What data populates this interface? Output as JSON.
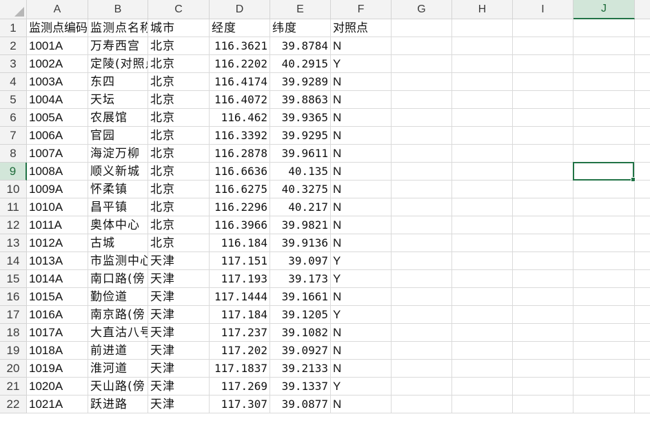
{
  "sheet": {
    "columns": [
      "A",
      "B",
      "C",
      "D",
      "E",
      "F",
      "G",
      "H",
      "I",
      "J"
    ],
    "active_column": "J",
    "active_row": 9,
    "rows": [
      {
        "n": "1",
        "a": "监测点编码",
        "b": "监测点名称",
        "c": "城市",
        "d": "经度",
        "e": "纬度",
        "f": "对照点"
      },
      {
        "n": "2",
        "a": "1001A",
        "b": "万寿西宫",
        "c": "北京",
        "d": "116.3621",
        "e": "39.8784",
        "f": "N"
      },
      {
        "n": "3",
        "a": "1002A",
        "b": "定陵(对照点)",
        "c": "北京",
        "d": "116.2202",
        "e": "40.2915",
        "f": "Y"
      },
      {
        "n": "4",
        "a": "1003A",
        "b": "东四",
        "c": "北京",
        "d": "116.4174",
        "e": "39.9289",
        "f": "N"
      },
      {
        "n": "5",
        "a": "1004A",
        "b": "天坛",
        "c": "北京",
        "d": "116.4072",
        "e": "39.8863",
        "f": "N"
      },
      {
        "n": "6",
        "a": "1005A",
        "b": "农展馆",
        "c": "北京",
        "d": "116.462",
        "e": "39.9365",
        "f": "N"
      },
      {
        "n": "7",
        "a": "1006A",
        "b": "官园",
        "c": "北京",
        "d": "116.3392",
        "e": "39.9295",
        "f": "N"
      },
      {
        "n": "8",
        "a": "1007A",
        "b": "海淀万柳",
        "c": "北京",
        "d": "116.2878",
        "e": "39.9611",
        "f": "N"
      },
      {
        "n": "9",
        "a": "1008A",
        "b": "顺义新城",
        "c": "北京",
        "d": "116.6636",
        "e": "40.135",
        "f": "N"
      },
      {
        "n": "10",
        "a": "1009A",
        "b": "怀柔镇",
        "c": "北京",
        "d": "116.6275",
        "e": "40.3275",
        "f": "N"
      },
      {
        "n": "11",
        "a": "1010A",
        "b": "昌平镇",
        "c": "北京",
        "d": "116.2296",
        "e": "40.217",
        "f": "N"
      },
      {
        "n": "12",
        "a": "1011A",
        "b": "奥体中心",
        "c": "北京",
        "d": "116.3966",
        "e": "39.9821",
        "f": "N"
      },
      {
        "n": "13",
        "a": "1012A",
        "b": "古城",
        "c": "北京",
        "d": "116.184",
        "e": "39.9136",
        "f": "N"
      },
      {
        "n": "14",
        "a": "1013A",
        "b": "市监测中心",
        "c": "天津",
        "d": "117.151",
        "e": "39.097",
        "f": "Y"
      },
      {
        "n": "15",
        "a": "1014A",
        "b": "南口路(傍",
        "c": "天津",
        "d": "117.193",
        "e": "39.173",
        "f": "Y"
      },
      {
        "n": "16",
        "a": "1015A",
        "b": "勤俭道",
        "c": "天津",
        "d": "117.1444",
        "e": "39.1661",
        "f": "N"
      },
      {
        "n": "17",
        "a": "1016A",
        "b": "南京路(傍",
        "c": "天津",
        "d": "117.184",
        "e": "39.1205",
        "f": "Y"
      },
      {
        "n": "18",
        "a": "1017A",
        "b": "大直沽八号",
        "c": "天津",
        "d": "117.237",
        "e": "39.1082",
        "f": "N"
      },
      {
        "n": "19",
        "a": "1018A",
        "b": "前进道",
        "c": "天津",
        "d": "117.202",
        "e": "39.0927",
        "f": "N"
      },
      {
        "n": "20",
        "a": "1019A",
        "b": "淮河道",
        "c": "天津",
        "d": "117.1837",
        "e": "39.2133",
        "f": "N"
      },
      {
        "n": "21",
        "a": "1020A",
        "b": "天山路(傍",
        "c": "天津",
        "d": "117.269",
        "e": "39.1337",
        "f": "Y"
      },
      {
        "n": "22",
        "a": "1021A",
        "b": "跃进路",
        "c": "天津",
        "d": "117.307",
        "e": "39.0877",
        "f": "N"
      }
    ]
  },
  "colors": {
    "accent": "#217346",
    "active_header_bg": "#d2e6d9",
    "header_bg": "#f3f3f3",
    "gridline": "#dadada"
  }
}
